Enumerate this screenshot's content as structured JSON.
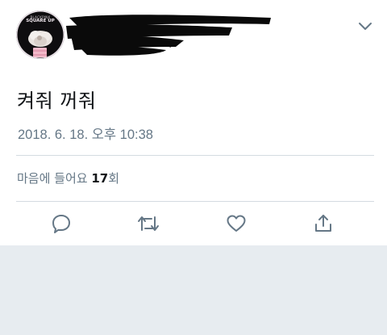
{
  "avatar": {
    "brand_line1": "BLACKPINK",
    "brand_line2": "SQUARE UP"
  },
  "tweet": {
    "text": "켜줘 꺼줘",
    "timestamp": "2018. 6. 18. 오후 10:38"
  },
  "likes": {
    "prefix": "마음에 들어요",
    "count": "17",
    "suffix": "회"
  },
  "actions": [
    {
      "name": "reply-icon"
    },
    {
      "name": "retweet-icon"
    },
    {
      "name": "like-icon"
    },
    {
      "name": "share-icon"
    }
  ],
  "colors": {
    "text_primary": "#14171a",
    "text_secondary": "#657786",
    "divider": "#d4dbe1",
    "background_gray": "#e7ecf0"
  }
}
